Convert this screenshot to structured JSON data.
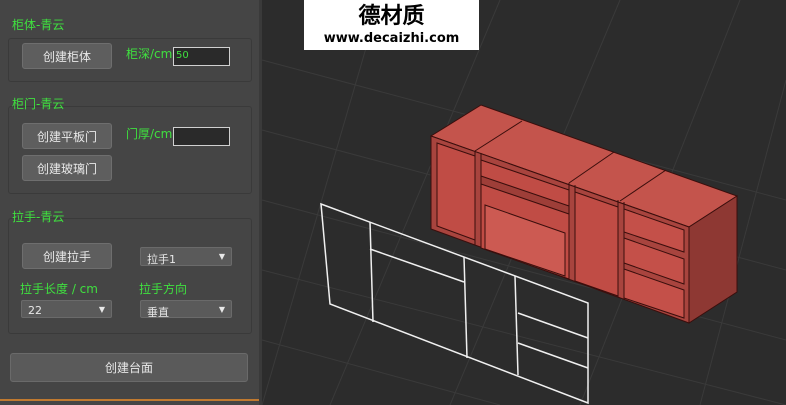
{
  "cabinet_group": {
    "title": "柜体-青云",
    "create_button": "创建柜体",
    "depth_label": "柜深/cm",
    "depth_value": "50"
  },
  "door_group": {
    "title": "柜门-青云",
    "flat_door_button": "创建平板门",
    "glass_door_button": "创建玻璃门",
    "thickness_label": "门厚/cm",
    "thickness_value": ""
  },
  "handle_group": {
    "title": "拉手-青云",
    "create_button": "创建拉手",
    "handle_type_selected": "拉手1",
    "length_label": "拉手长度 / cm",
    "length_selected": "22",
    "direction_label": "拉手方向",
    "direction_selected": "垂直"
  },
  "countertop_button": "创建台面",
  "watermark": {
    "title": "德材质",
    "url": "www.decaizhi.com"
  },
  "colors": {
    "panel_bg": "#454545",
    "label_green": "#3fe03f",
    "viewport_bg": "#2c2c2c",
    "cabinet_red": "#c0504a"
  }
}
